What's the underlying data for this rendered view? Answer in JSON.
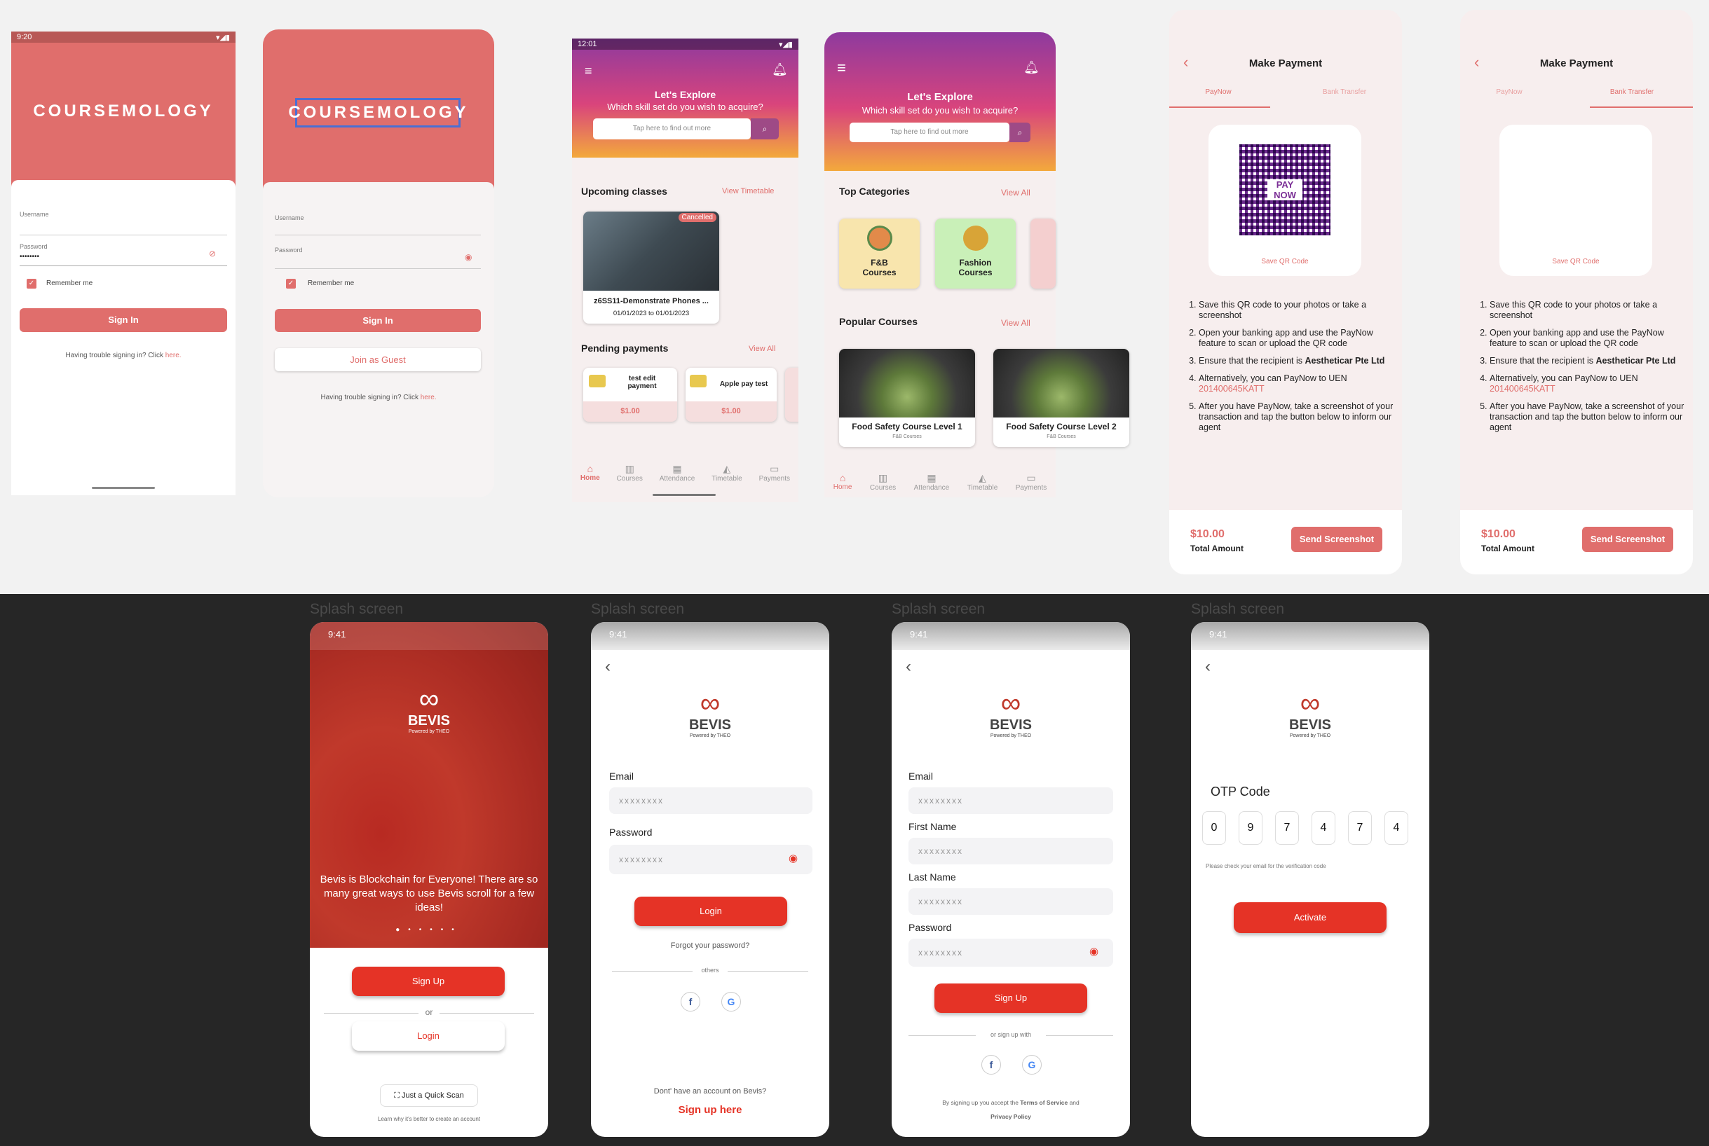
{
  "colors": {
    "coral": "#e06e6c",
    "bevis_red": "#e53326",
    "dark_bg": "#262626"
  },
  "cm_login1": {
    "status_time": "9:20",
    "logo": "COURSEMOLOGY",
    "username_label": "Username",
    "password_label": "Password",
    "password_value": "••••••••",
    "remember": "Remember me",
    "signin": "Sign In",
    "trouble": "Having trouble signing in? Click",
    "here": "here."
  },
  "cm_login2": {
    "logo": "COURSEMOLOGY",
    "username_label": "Username",
    "password_label": "Password",
    "remember": "Remember me",
    "signin": "Sign In",
    "guest": "Join as Guest",
    "trouble": "Having trouble signing in? Click",
    "here": "here."
  },
  "home1": {
    "status_time": "12:01",
    "title": "Let's Explore",
    "subtitle": "Which skill set do you wish to acquire?",
    "search_placeholder": "Tap here to find out more",
    "upcoming": "Upcoming classes",
    "view_timetable": "View Timetable",
    "class_badge": "Cancelled",
    "class_title": "z6SS11-Demonstrate Phones ...",
    "class_dates": "01/01/2023 to 01/01/2023",
    "pending": "Pending payments",
    "view_all": "View All",
    "payments": [
      {
        "title": "test edit payment",
        "amount": "$1.00"
      },
      {
        "title": "Apple pay test",
        "amount": "$1.00"
      }
    ],
    "nav": [
      "Home",
      "Courses",
      "Attendance",
      "Timetable",
      "Payments"
    ]
  },
  "home2": {
    "title": "Let's Explore",
    "subtitle": "Which skill set do you wish to acquire?",
    "search_placeholder": "Tap here to find out more",
    "top_categories": "Top Categories",
    "view_all": "View All",
    "categories": [
      {
        "name": "F&B Courses"
      },
      {
        "name": "Fashion Courses"
      }
    ],
    "popular": "Popular Courses",
    "courses": [
      {
        "title": "Food Safety Course Level 1",
        "category": "F&B Courses"
      },
      {
        "title": "Food Safety Course Level 2",
        "category": "F&B Courses"
      }
    ],
    "nav": [
      "Home",
      "Courses",
      "Attendance",
      "Timetable",
      "Payments"
    ]
  },
  "payment": {
    "title": "Make Payment",
    "tabs": [
      "PayNow",
      "Bank Transfer"
    ],
    "qr_text": "PAY NOW",
    "save_qr": "Save QR Code",
    "steps": [
      "Save this QR code to your photos or take a screenshot",
      "Open your banking app and use the PayNow feature to scan or upload the QR code",
      "Ensure that the recipient is",
      "Alternatively, you can PayNow to UEN",
      "After you have PayNow, take a screenshot of your transaction and tap the button below to inform our agent"
    ],
    "recipient": "Aestheticar Pte Ltd",
    "uen": "201400645KATT",
    "amount": "$10.00",
    "total_label": "Total Amount",
    "send": "Send Screenshot"
  },
  "bevis": {
    "caption": "Splash screen",
    "status_time": "9:41",
    "brand": "BEVIS",
    "powered": "Powered by THEO",
    "splash_text": "Bevis is Blockchain for Everyone! There are so many great ways to use Bevis scroll for a few ideas!",
    "signup": "Sign Up",
    "or": "or",
    "login": "Login",
    "quick_scan": "Just a Quick Scan",
    "learn_why": "Learn why it's better to create an account",
    "email": "Email",
    "password": "Password",
    "first_name": "First Name",
    "last_name": "Last Name",
    "placeholder": "xxxxxxxx",
    "forgot": "Forgot your password?",
    "others": "others",
    "no_account": "Dont' have an account on Bevis?",
    "signup_here": "Sign up here",
    "or_signup_with": "or sign up with",
    "terms_prefix": "By signing up you accept the",
    "terms": "Terms of Service",
    "and": "and",
    "privacy": "Privacy Policy",
    "otp_title": "OTP Code",
    "otp_digits": [
      "0",
      "9",
      "7",
      "4",
      "7",
      "4"
    ],
    "otp_hint": "Please check your email for the verification code",
    "activate": "Activate"
  }
}
